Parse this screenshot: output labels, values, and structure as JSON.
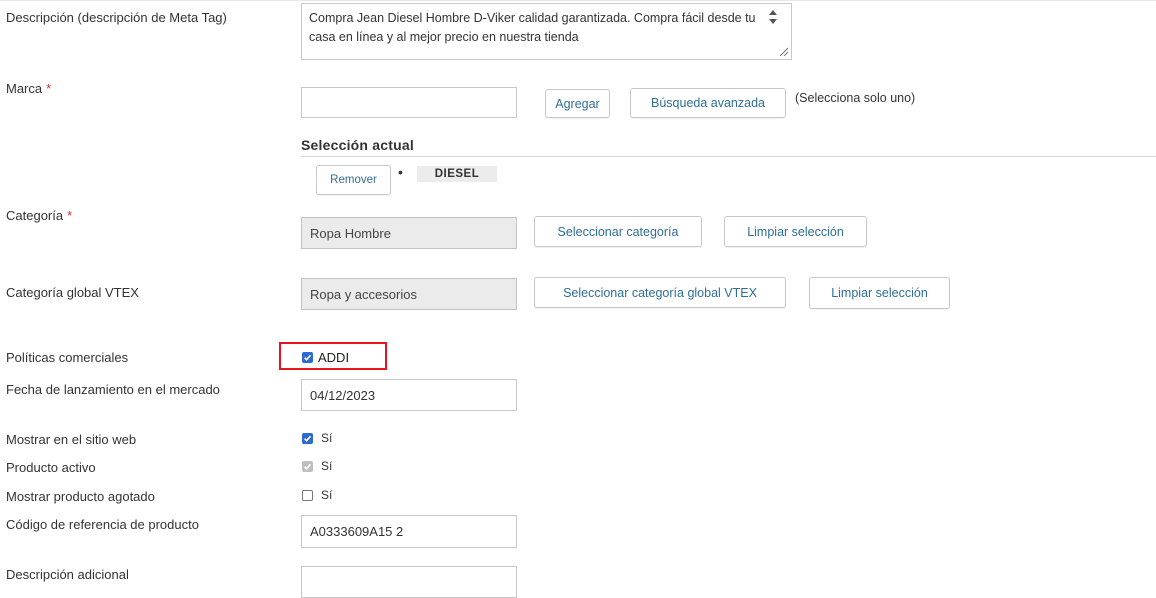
{
  "meta_description": {
    "label": "Descripción (descripción de Meta Tag)",
    "value": "Compra Jean Diesel Hombre D-Viker calidad garantizada. Compra fácil desde tu casa en línea y al mejor precio en nuestra tienda"
  },
  "brand": {
    "label": "Marca",
    "required_mark": "*",
    "input_value": "",
    "add_button": "Agregar",
    "advanced_search_button": "Búsqueda avanzada",
    "hint": "(Selecciona solo uno)",
    "current_selection_title": "Selección actual",
    "remove_button": "Remover",
    "bullet": "•",
    "selected_value": "DIESEL"
  },
  "category": {
    "label": "Categoría",
    "required_mark": "*",
    "value": "Ropa Hombre",
    "select_button": "Seleccionar categoría",
    "clear_button": "Limpiar selección"
  },
  "global_category": {
    "label": "Categoría global VTEX",
    "value": "Ropa y accesorios",
    "select_button": "Seleccionar categoría global VTEX",
    "clear_button": "Limpiar selección"
  },
  "trade_policies": {
    "label": "Políticas comerciales",
    "option": "ADDI",
    "checked": true,
    "highlight_color": "#e8141b"
  },
  "release_date": {
    "label": "Fecha de lanzamiento en el mercado",
    "value": "04/12/2023"
  },
  "show_on_site": {
    "label": "Mostrar en el sitio web",
    "option": "Sí",
    "checked": true
  },
  "active_product": {
    "label": "Producto activo",
    "option": "Sí",
    "checked": true,
    "disabled": true
  },
  "show_sold_out": {
    "label": "Mostrar producto agotado",
    "option": "Sí",
    "checked": false
  },
  "reference_code": {
    "label": "Código de referencia de producto",
    "value": "A0333609A15 2"
  },
  "additional_description": {
    "label": "Descripción adicional",
    "value": ""
  },
  "colors": {
    "link": "#2e6e97",
    "checkbox": "#2f6ad0",
    "required": "#e0282e"
  }
}
